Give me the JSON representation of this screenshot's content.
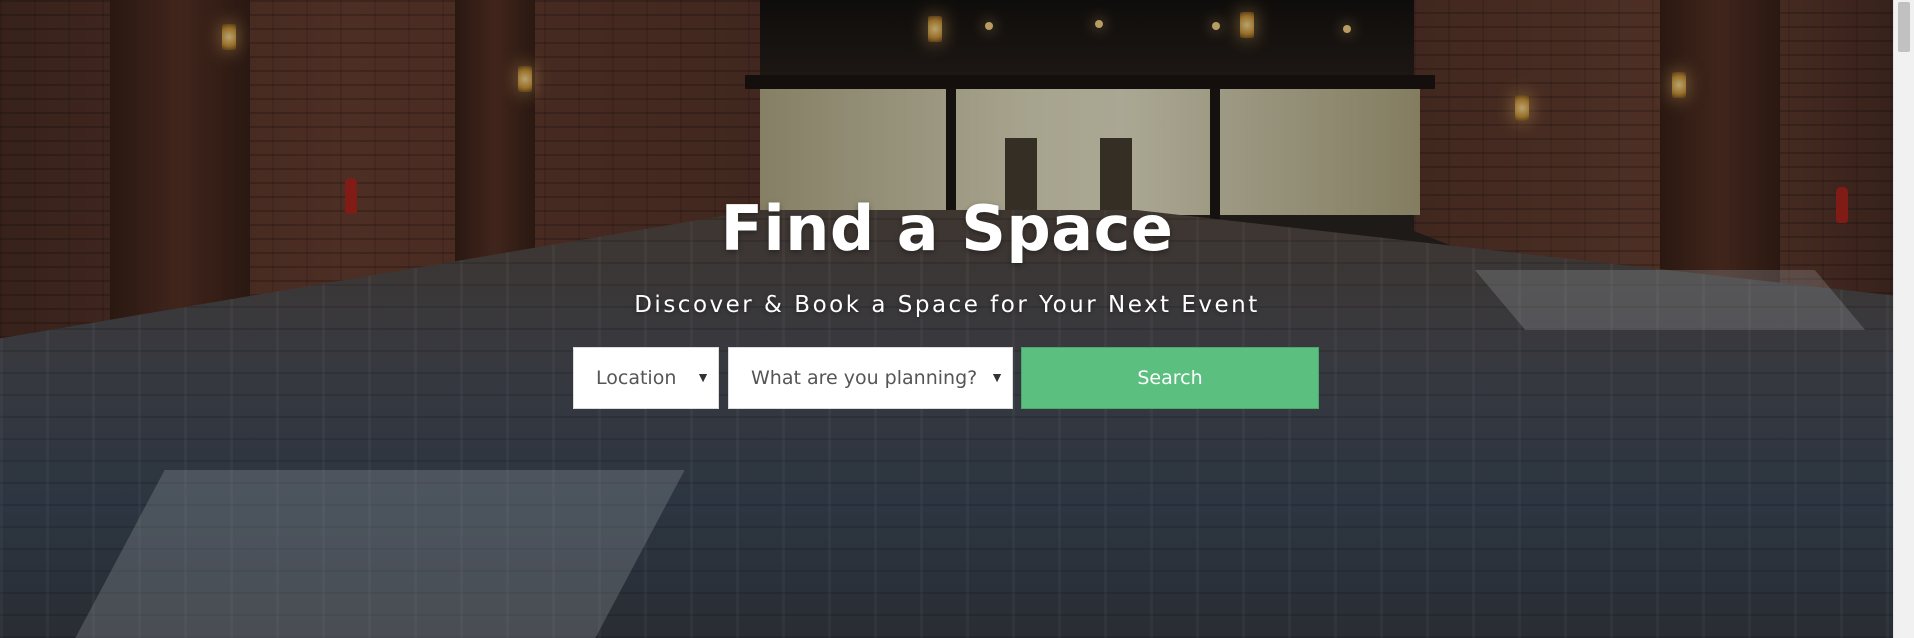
{
  "hero": {
    "title": "Find a Space",
    "subtitle": "Discover & Book a Space for Your Next Event"
  },
  "search": {
    "location_select": {
      "selected": "Location",
      "icon": "chevron-down-icon"
    },
    "event_select": {
      "selected": "What are you planning?",
      "icon": "chevron-down-icon"
    },
    "button_label": "Search"
  },
  "colors": {
    "search_button": "#5bbf7f",
    "text": "#ffffff"
  }
}
